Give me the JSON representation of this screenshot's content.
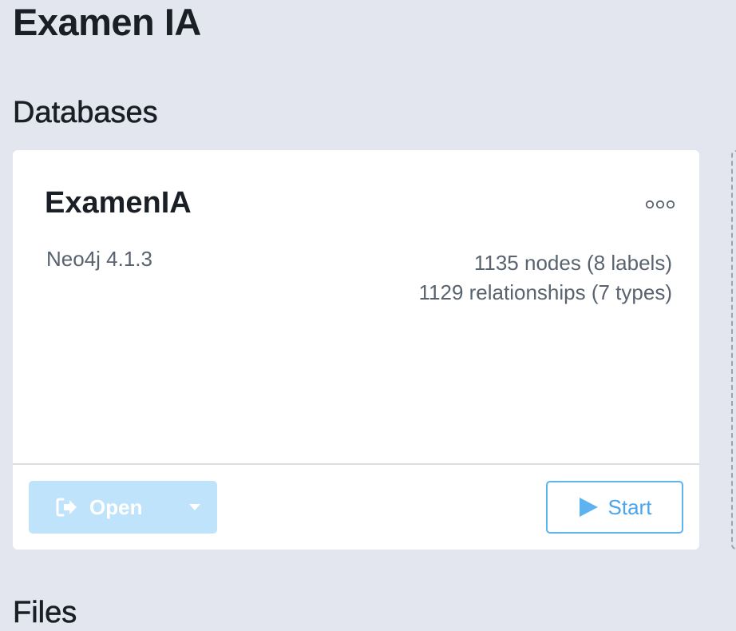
{
  "project": {
    "title": "Examen IA"
  },
  "sections": {
    "databases_title": "Databases",
    "files_title": "Files"
  },
  "database": {
    "name": "ExamenIA",
    "version": "Neo4j 4.1.3",
    "nodes_text": "1135 nodes (8 labels)",
    "relationships_text": "1129 relationships (7 types)",
    "more_icon": "more-horizontal-icon"
  },
  "actions": {
    "open_label": "Open",
    "open_icon": "sign-in-icon",
    "dropdown_icon": "caret-down-icon",
    "start_label": "Start",
    "start_icon": "play-icon"
  },
  "colors": {
    "background": "#e3e6ee",
    "card": "#ffffff",
    "open_button_disabled": "#bfe3fa",
    "start_accent": "#4aa4ec",
    "muted_text": "#59636f"
  }
}
